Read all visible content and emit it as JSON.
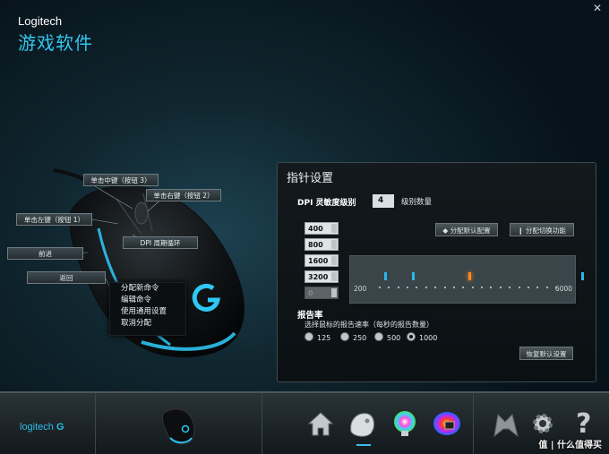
{
  "window": {
    "brand": "Logitech",
    "title": "游戏软件",
    "close_icon": "close-icon"
  },
  "mouse_labels": {
    "middle": "单击中键（按钮 3）",
    "right": "单击右键（按钮 2）",
    "left": "单击左键（按钮 1）",
    "dpi_cycle": "DPI 周期循环",
    "forward": "前进",
    "back": "返回"
  },
  "context_menu": [
    "分配新命令",
    "编辑命令",
    "使用通用设置",
    "取消分配"
  ],
  "panel": {
    "title": "指针设置",
    "dpi_label": "DPI 灵敏度级别",
    "dpi_count": "4",
    "dpi_count_label": "级别数量",
    "dpi_levels": [
      "400",
      "800",
      "1600",
      "3200",
      "0"
    ],
    "assign_default_button": "◆ 分配默认配置",
    "assign_switch_button": "❙ 分配切换功能",
    "slider_min": "200",
    "slider_max": "6000",
    "slider_values": [
      400,
      800,
      1600,
      3200
    ],
    "slider_active": 1600,
    "report_rate_title": "报告率",
    "report_rate_desc": "选择鼠标的报告速率（每秒的报告数量）",
    "report_rates": [
      "125",
      "250",
      "500",
      "1000"
    ],
    "report_rate_selected": "1000",
    "restore_button": "恢复默认设置"
  },
  "bottom": {
    "logo": "logitech",
    "nav_icons": [
      "home-icon",
      "pointer-settings-icon",
      "lighting-icon",
      "heatmap-icon",
      "logitech-arx-icon",
      "settings-gear-icon",
      "help-icon"
    ]
  },
  "watermark": "值 | 什么值得买",
  "colors": {
    "accent": "#2bbde8",
    "active_tick": "#ff8a1c"
  }
}
